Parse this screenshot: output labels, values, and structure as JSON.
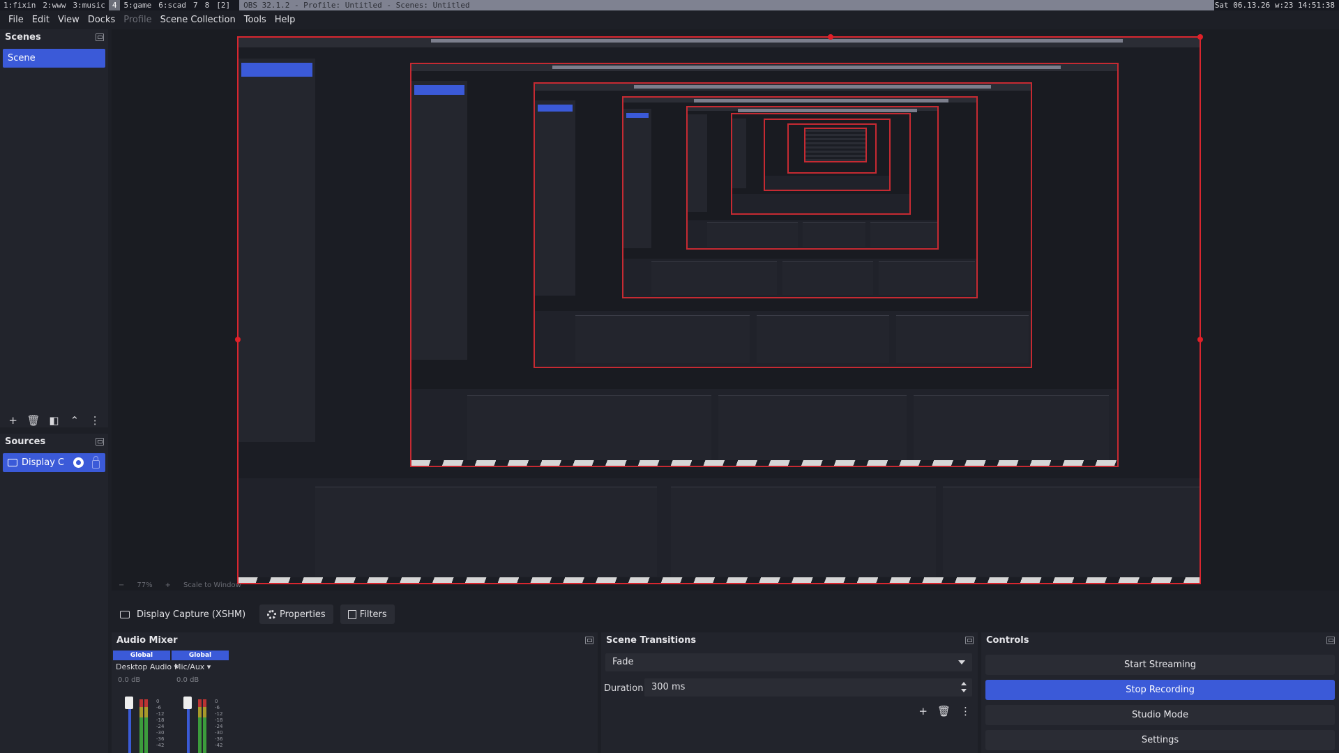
{
  "wm": {
    "workspaces": [
      "1:fixin",
      "2:www",
      "3:music",
      "4",
      "5:game",
      "6:scad",
      "7",
      "8",
      "[2]"
    ],
    "active_workspace": "4",
    "window_title": "OBS 32.1.2 - Profile: Untitled - Scenes: Untitled",
    "clock": "Sat 06.13.26 w:23 14:51:38"
  },
  "menubar": {
    "items": [
      "File",
      "Edit",
      "View",
      "Docks",
      "Profile",
      "Scene Collection",
      "Tools",
      "Help"
    ],
    "disabled": [
      "Profile"
    ]
  },
  "scenes": {
    "title": "Scenes",
    "items": [
      "Scene"
    ],
    "toolbar": [
      "+",
      "🗑",
      "◧",
      "⌃",
      "⋮"
    ]
  },
  "sources": {
    "title": "Sources",
    "items": [
      "Display C"
    ]
  },
  "preview": {
    "zoom_text": [
      "−",
      "77%",
      "+",
      "Scale to Window"
    ]
  },
  "source_toolbar": {
    "name": "Display Capture (XSHM)",
    "properties_label": "Properties",
    "filters_label": "Filters"
  },
  "audio_mixer": {
    "title": "Audio Mixer",
    "channels": [
      {
        "badge": "Global",
        "name": "Desktop Audio",
        "db": "0.0 dB"
      },
      {
        "badge": "Global",
        "name": "Mic/Aux",
        "db": "0.0 dB"
      }
    ],
    "scale": [
      "0",
      "-6",
      "-12",
      "-18",
      "-24",
      "-30",
      "-36",
      "-42"
    ]
  },
  "scene_transitions": {
    "title": "Scene Transitions",
    "transition": "Fade",
    "duration_label": "Duration",
    "duration_value": "300 ms"
  },
  "controls": {
    "title": "Controls",
    "buttons": [
      "Start Streaming",
      "Stop Recording",
      "Studio Mode",
      "Settings"
    ],
    "active_button": "Stop Recording",
    "accent": "#3b5ad8"
  },
  "colors": {
    "accent": "#3b5ad8",
    "preview_border": "#d9262f",
    "background": "#1d1f26"
  }
}
